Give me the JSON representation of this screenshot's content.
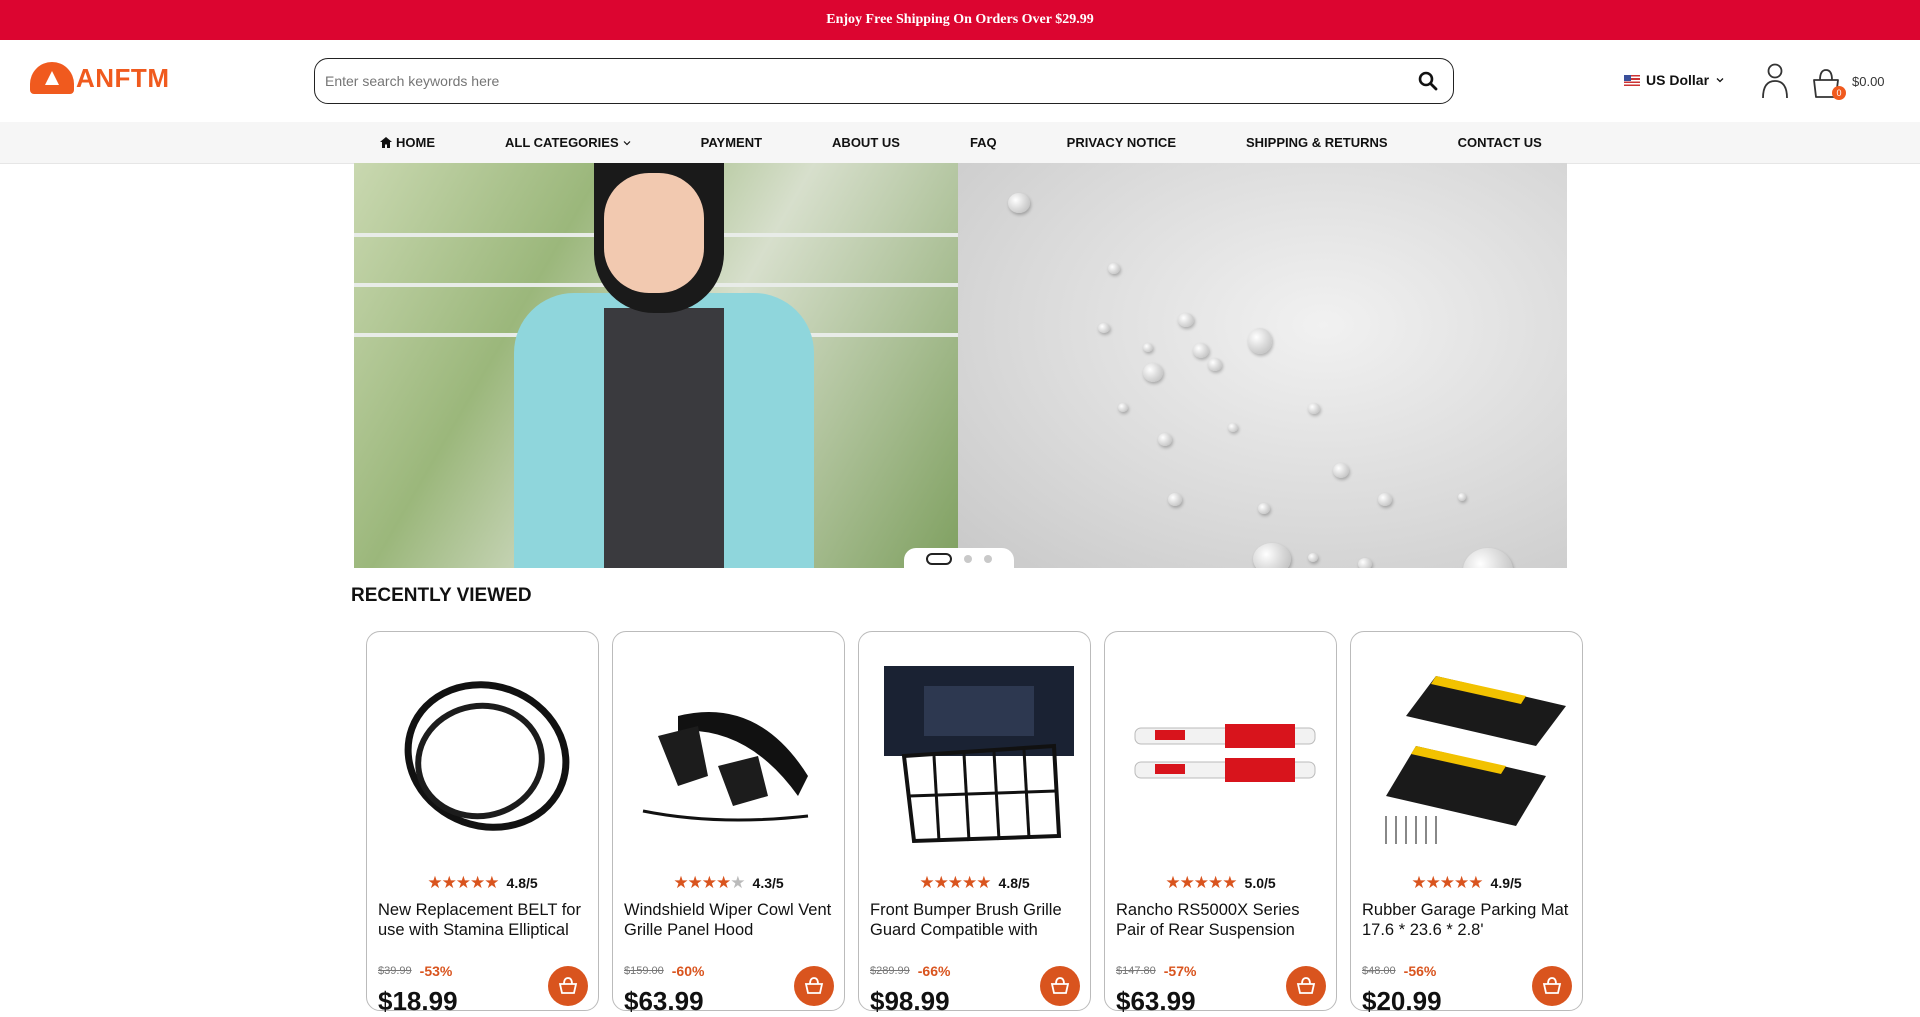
{
  "announcement": "Enjoy Free Shipping On Orders Over $29.99",
  "brand": {
    "logo_text": "ANFTM",
    "accent": "#f05a1e",
    "banner_red": "#dc0530"
  },
  "search": {
    "placeholder": "Enter search keywords here",
    "value": "",
    "icon": "search-icon"
  },
  "currency": {
    "label": "US Dollar",
    "flag": "us-flag"
  },
  "cart": {
    "count": "0",
    "total": "$0.00"
  },
  "nav": [
    {
      "label": "HOME",
      "icon": "home-icon"
    },
    {
      "label": "ALL CATEGORIES",
      "icon": "chevron-down-icon"
    },
    {
      "label": "PAYMENT"
    },
    {
      "label": "ABOUT US"
    },
    {
      "label": "FAQ"
    },
    {
      "label": "PRIVACY NOTICE"
    },
    {
      "label": "SHIPPING & RETURNS"
    },
    {
      "label": "CONTACT US"
    }
  ],
  "carousel": {
    "slides": 3,
    "active": 1
  },
  "recently_viewed": {
    "title": "RECENTLY VIEWED",
    "products": [
      {
        "rating": "4.8/5",
        "stars": 4.8,
        "title": "New Replacement BELT for use with Stamina Elliptical",
        "old_price": "$39.99",
        "discount": "-53%",
        "price": "$18.99",
        "image": "belt"
      },
      {
        "rating": "4.3/5",
        "stars": 4.3,
        "title": "Windshield Wiper Cowl Vent Grille Panel Hood",
        "old_price": "$159.00",
        "discount": "-60%",
        "price": "$63.99",
        "image": "cowl"
      },
      {
        "rating": "4.8/5",
        "stars": 4.8,
        "title": "Front Bumper Brush Grille Guard Compatible with",
        "old_price": "$289.99",
        "discount": "-66%",
        "price": "$98.99",
        "image": "grille"
      },
      {
        "rating": "5.0/5",
        "stars": 5.0,
        "title": "Rancho RS5000X Series Pair of Rear Suspension",
        "old_price": "$147.80",
        "discount": "-57%",
        "price": "$63.99",
        "image": "shocks"
      },
      {
        "rating": "4.9/5",
        "stars": 4.9,
        "title": "Rubber Garage Parking Mat 17.6 * 23.6 * 2.8'",
        "old_price": "$48.00",
        "discount": "-56%",
        "price": "$20.99",
        "image": "mat"
      }
    ]
  }
}
